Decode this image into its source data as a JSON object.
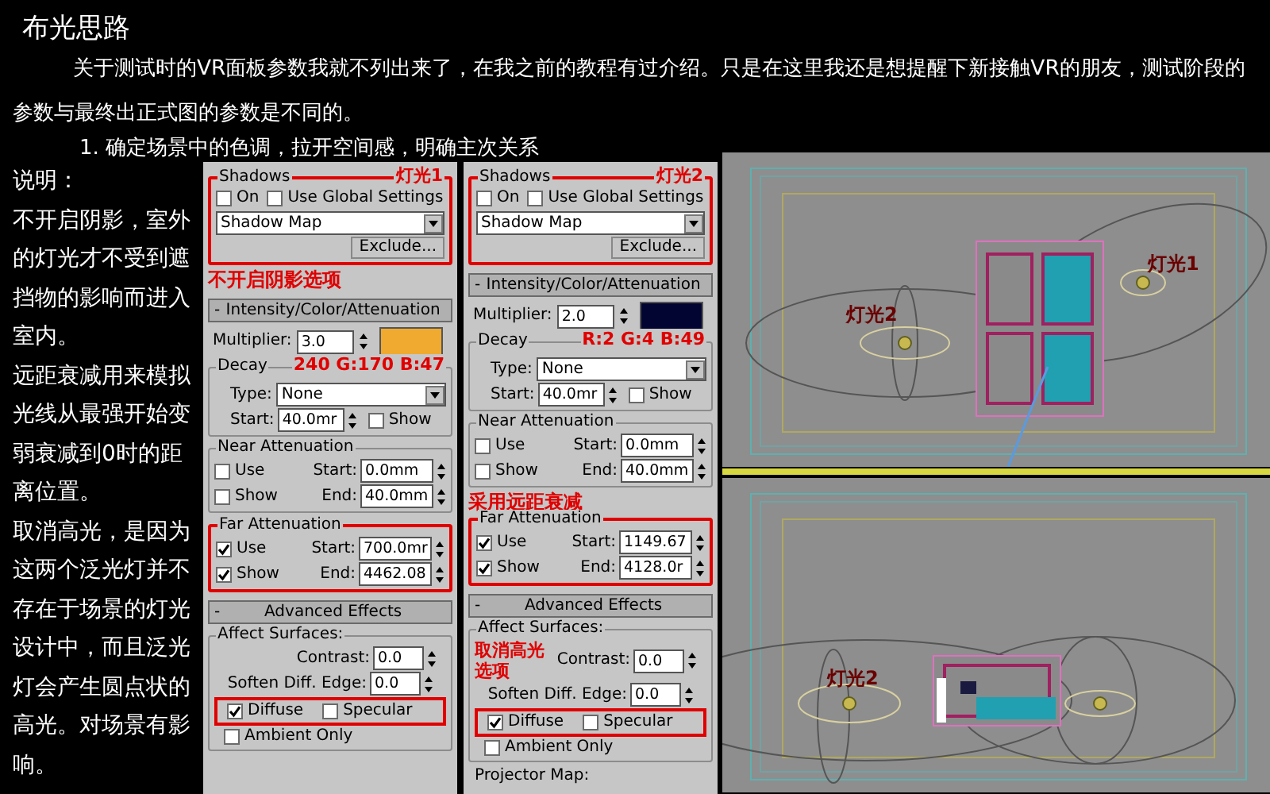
{
  "title": "布光思路",
  "intro": "关于测试时的VR面板参数我就不列出来了，在我之前的教程有过介绍。只是在这里我还是想提醒下新接触VR的朋友，测试阶段的参数与最终出正式图的参数是不同的。",
  "step": "1. 确定场景中的色调，拉开空间感，明确主次关系",
  "notes": {
    "heading": "说明：",
    "paragraphs": [
      "不开启阴影，室外的灯光才不受到遮挡物的影响而进入室内。",
      "远距衰减用来模拟光线从最强开始变弱衰减到0时的距离位置。",
      "取消高光，是因为这两个泛光灯并不存在于场景的灯光设计中，而且泛光灯会产生圆点状的高光。对场景有影响。"
    ]
  },
  "panels": [
    {
      "shadows": {
        "label": "Shadows",
        "note": "灯光1",
        "highlighted": true,
        "on": {
          "label": "On",
          "checked": false
        },
        "global": {
          "label": "Use Global Settings",
          "checked": false
        },
        "type": "Shadow Map",
        "exclude": "Exclude...",
        "note_below": "不开启阴影选项"
      },
      "intensity": {
        "sign": "-",
        "header": "Intensity/Color/Attenuation",
        "multiplier_label": "Multiplier:",
        "multiplier": "3.0",
        "color": "#f0aa2f"
      },
      "decay": {
        "label": "Decay",
        "note": "240 G:170 B:47",
        "type_label": "Type:",
        "type": "None",
        "start_label": "Start:",
        "start": "40.0mr",
        "show": {
          "label": "Show",
          "checked": false
        }
      },
      "near": {
        "label": "Near Attenuation",
        "highlighted": false,
        "use": {
          "label": "Use",
          "checked": false
        },
        "show": {
          "label": "Show",
          "checked": false
        },
        "start_label": "Start:",
        "start": "0.0mm",
        "end_label": "End:",
        "end": "40.0mm"
      },
      "far": {
        "label": "Far Attenuation",
        "highlighted": true,
        "use": {
          "label": "Use",
          "checked": true
        },
        "show": {
          "label": "Show",
          "checked": true
        },
        "start_label": "Start:",
        "start": "700.0mr",
        "end_label": "End:",
        "end": "4462.08"
      },
      "advanced": {
        "sign": "-",
        "header": "Advanced Effects",
        "label": "Affect Surfaces:",
        "contrast_label": "Contrast:",
        "contrast": "0.0",
        "soften_label": "Soften Diff. Edge:",
        "soften": "0.0",
        "highlighted": true,
        "diffuse": {
          "label": "Diffuse",
          "checked": true
        },
        "specular": {
          "label": "Specular",
          "checked": false
        },
        "ambient": {
          "label": "Ambient Only",
          "checked": false
        }
      }
    },
    {
      "shadows": {
        "label": "Shadows",
        "note": "灯光2",
        "highlighted": true,
        "on": {
          "label": "On",
          "checked": false
        },
        "global": {
          "label": "Use Global Settings",
          "checked": false
        },
        "type": "Shadow Map",
        "exclude": "Exclude..."
      },
      "intensity": {
        "sign": "-",
        "header": "Intensity/Color/Attenuation",
        "multiplier_label": "Multiplier:",
        "multiplier": "2.0",
        "color": "#020431"
      },
      "decay": {
        "label": "Decay",
        "note": "R:2 G:4 B:49",
        "type_label": "Type:",
        "type": "None",
        "start_label": "Start:",
        "start": "40.0mr",
        "show": {
          "label": "Show",
          "checked": false
        }
      },
      "near": {
        "label": "Near Attenuation",
        "highlighted": false,
        "use": {
          "label": "Use",
          "checked": false
        },
        "show": {
          "label": "Show",
          "checked": false
        },
        "start_label": "Start:",
        "start": "0.0mm",
        "end_label": "End:",
        "end": "40.0mm"
      },
      "far": {
        "label": "Far Attenuation",
        "note_above": "采用远距衰减",
        "highlighted": true,
        "use": {
          "label": "Use",
          "checked": true
        },
        "show": {
          "label": "Show",
          "checked": true
        },
        "start_label": "Start:",
        "start": "1149.67",
        "end_label": "End:",
        "end": "4128.0r"
      },
      "advanced": {
        "sign": "-",
        "header": "Advanced Effects",
        "label": "Affect Surfaces:",
        "note_above": "取消高光选项",
        "contrast_label": "Contrast:",
        "contrast": "0.0",
        "soften_label": "Soften Diff. Edge:",
        "soften": "0.0",
        "highlighted": true,
        "diffuse": {
          "label": "Diffuse",
          "checked": true
        },
        "specular": {
          "label": "Specular",
          "checked": false
        },
        "ambient": {
          "label": "Ambient Only",
          "checked": false
        }
      },
      "projector": "Projector Map:"
    }
  ],
  "viewport": {
    "views": [
      {
        "labels": [
          "灯光1",
          "灯光2"
        ]
      },
      {
        "labels": [
          "灯光2"
        ]
      }
    ]
  }
}
